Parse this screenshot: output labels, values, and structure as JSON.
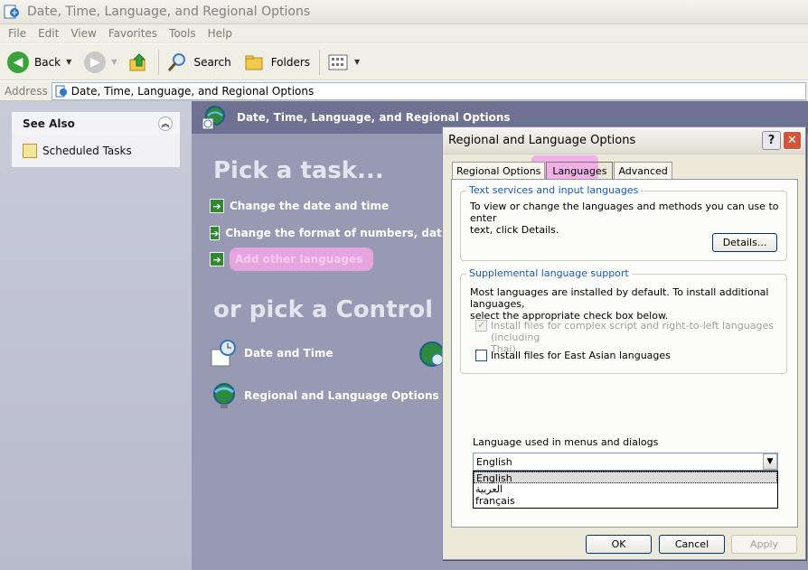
{
  "window": {
    "title": "Date, Time, Language, and Regional Options"
  },
  "menubar": [
    "File",
    "Edit",
    "View",
    "Favorites",
    "Tools",
    "Help"
  ],
  "toolbar": {
    "back": "Back",
    "search": "Search",
    "folders": "Folders"
  },
  "address": {
    "label": "Address",
    "value": "Date, Time, Language, and Regional Options"
  },
  "see_also": {
    "title": "See Also",
    "items": [
      "Scheduled Tasks"
    ]
  },
  "main": {
    "header": "Date, Time, Language, and Regional Options",
    "pick_task": "Pick a task...",
    "tasks": [
      "Change the date and time",
      "Change the format of numbers, dates, and",
      "Add other languages"
    ],
    "or_pick": "or pick a Control Panel icon",
    "icons": [
      "Date and Time",
      "Regional and Language Options"
    ]
  },
  "dialog": {
    "title": "Regional and Language Options",
    "help_glyph": "?",
    "close_glyph": "✕",
    "tabs": [
      "Regional Options",
      "Languages",
      "Advanced"
    ],
    "active_tab": "Languages",
    "group1": {
      "title": "Text services and input languages",
      "text_line1": "To view or change the languages and methods you can use to enter",
      "text_line2": "text, click Details.",
      "details_button": "Details..."
    },
    "group2": {
      "title": "Supplemental language support",
      "text_line1": "Most languages are installed by default. To install additional languages,",
      "text_line2": "select the appropriate check box below.",
      "check1_line1": "Install files for complex script and right-to-left languages (including",
      "check1_line2": "Thai)",
      "check1_checked": true,
      "check2": "Install files for East Asian languages",
      "check2_checked": false
    },
    "menu_language_label": "Language used in menus and dialogs",
    "menu_language_value": "English",
    "dropdown_options": [
      "English",
      "العربية",
      "français"
    ],
    "ok": "OK",
    "cancel": "Cancel",
    "apply": "Apply"
  }
}
